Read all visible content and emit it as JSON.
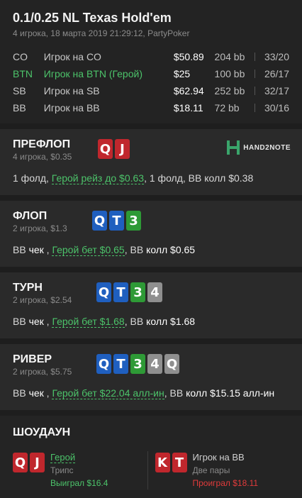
{
  "header": {
    "title": "0.1/0.25 NL Texas Hold'em",
    "subtitle": "4 игрока, 18 марта 2019 21:29:12, PartyPoker"
  },
  "players": [
    {
      "pos": "CO",
      "name": "Игрок на CO",
      "stack": "$50.89",
      "bb": "204 bb",
      "vpip": "33/20",
      "hero": false
    },
    {
      "pos": "BTN",
      "name": "Игрок на BTN (Герой)",
      "stack": "$25",
      "bb": "100 bb",
      "vpip": "26/17",
      "hero": true
    },
    {
      "pos": "SB",
      "name": "Игрок на SB",
      "stack": "$62.94",
      "bb": "252 bb",
      "vpip": "32/17",
      "hero": false
    },
    {
      "pos": "BB",
      "name": "Игрок на BB",
      "stack": "$18.11",
      "bb": "72 bb",
      "vpip": "30/16",
      "hero": false
    }
  ],
  "preflop": {
    "street": "ПРЕФЛОП",
    "sub": "4 игрока, $0.35",
    "logo": "HAND2NOTE",
    "a1": "1 фолд, ",
    "a2": "Герой рейз до $0.63",
    "a3": ", 1 фолд, ВВ колл $0.38"
  },
  "flop": {
    "street": "ФЛОП",
    "sub": "2 игрока, $1.3",
    "cards": [
      "Q",
      "T",
      "3"
    ],
    "a1": "ВВ ",
    "a1b": "чек",
    "a1c": " , ",
    "a2": "Герой бет $0.65",
    "a3": ", ВВ ",
    "a3b": "колл $0.65"
  },
  "turn": {
    "street": "ТУРН",
    "sub": "2 игрока, $2.54",
    "cards": [
      "Q",
      "T",
      "3",
      "4"
    ],
    "a1": "ВВ ",
    "a1b": "чек",
    "a1c": " , ",
    "a2": "Герой бет $1.68",
    "a3": ", ВВ ",
    "a3b": "колл $1.68"
  },
  "river": {
    "street": "РИВЕР",
    "sub": "2 игрока, $5.75",
    "cards": [
      "Q",
      "T",
      "3",
      "4",
      "Q"
    ],
    "a1": "ВВ ",
    "a1b": "чек",
    "a1c": " , ",
    "a2": "Герой бет $22.04 алл-ин",
    "a3": ", ВВ ",
    "a3b": "колл $15.15 алл-ин"
  },
  "hero_cards": [
    "Q",
    "J"
  ],
  "showdown": {
    "title": "ШОУДАУН",
    "hero": {
      "cards": [
        "Q",
        "J"
      ],
      "name": "Герой",
      "hand": "Трипс",
      "result": "Выиграл $16.4"
    },
    "villain": {
      "cards": [
        "K",
        "T"
      ],
      "name": "Игрок на ВВ",
      "hand": "Две пары",
      "result": "Проиграл $18.11"
    }
  },
  "colors": {
    "hearts": "#c0272d",
    "diamonds": "#1f5fbf",
    "clubs": "#2e9a36",
    "spades": "#8f8f8f",
    "hero": "#4cc36a",
    "lose": "#e03b3b"
  }
}
